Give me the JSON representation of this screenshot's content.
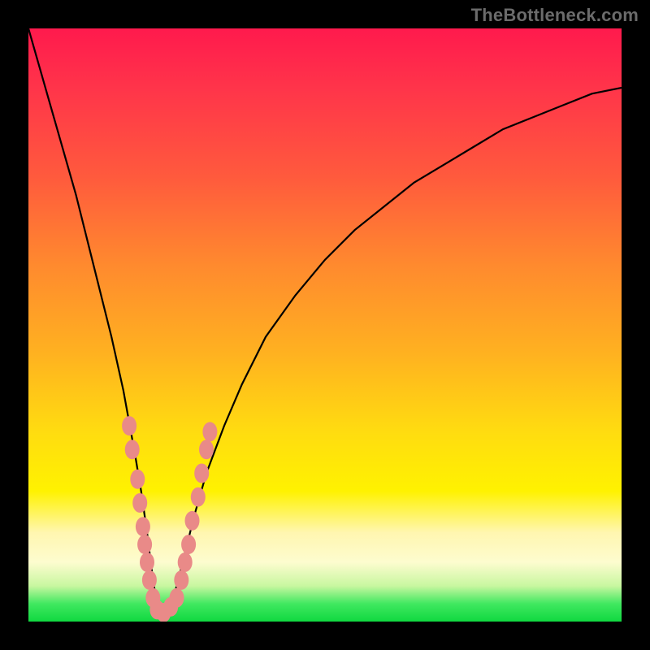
{
  "watermark": "TheBottleneck.com",
  "colors": {
    "frame": "#000000",
    "gradient_top": "#ff1a4d",
    "gradient_mid": "#ffdc10",
    "gradient_bottom": "#10d840",
    "curve": "#000000",
    "markers": "#e98a88"
  },
  "chart_data": {
    "type": "line",
    "title": "",
    "xlabel": "",
    "ylabel": "",
    "xlim": [
      0,
      100
    ],
    "ylim": [
      0,
      100
    ],
    "notes": "V-shaped bottleneck curve. Minimum near x≈22 where y≈0. Left branch steep; right branch asymptotes toward ~90. Pink marker dots cluster along the lower V near the minimum.",
    "series": [
      {
        "name": "curve",
        "x": [
          0,
          2,
          4,
          6,
          8,
          10,
          12,
          14,
          16,
          18,
          19,
          20,
          21,
          22,
          23,
          24,
          25,
          26,
          28,
          30,
          33,
          36,
          40,
          45,
          50,
          55,
          60,
          65,
          70,
          75,
          80,
          85,
          90,
          95,
          100
        ],
        "y": [
          100,
          93,
          86,
          79,
          72,
          64,
          56,
          48,
          39,
          28,
          22,
          15,
          7,
          1,
          1,
          3,
          6,
          10,
          18,
          25,
          33,
          40,
          48,
          55,
          61,
          66,
          70,
          74,
          77,
          80,
          83,
          85,
          87,
          89,
          90
        ]
      }
    ],
    "markers": [
      {
        "x": 17.0,
        "y": 33
      },
      {
        "x": 17.5,
        "y": 29
      },
      {
        "x": 18.4,
        "y": 24
      },
      {
        "x": 18.8,
        "y": 20
      },
      {
        "x": 19.3,
        "y": 16
      },
      {
        "x": 19.6,
        "y": 13
      },
      {
        "x": 20.0,
        "y": 10
      },
      {
        "x": 20.4,
        "y": 7
      },
      {
        "x": 21.0,
        "y": 4
      },
      {
        "x": 21.7,
        "y": 2
      },
      {
        "x": 22.8,
        "y": 1.5
      },
      {
        "x": 24.0,
        "y": 2.5
      },
      {
        "x": 25.0,
        "y": 4
      },
      {
        "x": 25.8,
        "y": 7
      },
      {
        "x": 26.4,
        "y": 10
      },
      {
        "x": 27.0,
        "y": 13
      },
      {
        "x": 27.6,
        "y": 17
      },
      {
        "x": 28.6,
        "y": 21
      },
      {
        "x": 29.2,
        "y": 25
      },
      {
        "x": 30.0,
        "y": 29
      },
      {
        "x": 30.6,
        "y": 32
      }
    ]
  }
}
